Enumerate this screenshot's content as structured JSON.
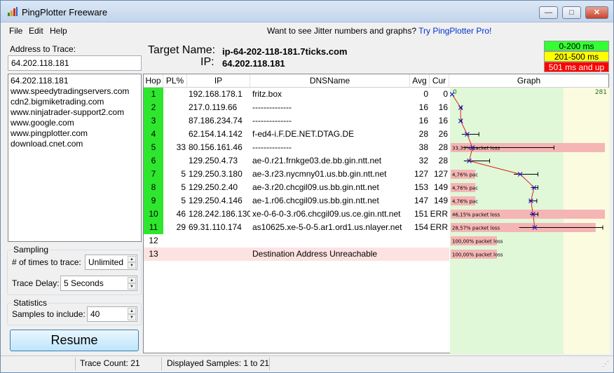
{
  "app": {
    "title": "PingPlotter Freeware"
  },
  "window_controls": {
    "minimize": "—",
    "maximize": "□",
    "close": "✕"
  },
  "menu": {
    "items": [
      "File",
      "Edit",
      "Help"
    ]
  },
  "promo": {
    "text": "Want to see Jitter numbers and graphs?",
    "link": "Try PingPlotter Pro!"
  },
  "address": {
    "label": "Address to Trace:",
    "value": "64.202.118.181"
  },
  "history": [
    "64.202.118.181",
    "www.speedytradingservers.com",
    "cdn2.bigmiketrading.com",
    "www.ninjatrader-support2.com",
    "www.google.com",
    "www.pingplotter.com",
    "download.cnet.com"
  ],
  "sampling": {
    "title": "Sampling",
    "times_label": "# of times to trace:",
    "times_value": "Unlimited",
    "delay_label": "Trace Delay:",
    "delay_value": "5 Seconds"
  },
  "statistics": {
    "title": "Statistics",
    "samples_label": "Samples to include:",
    "samples_value": "40"
  },
  "resume_button": {
    "label": "Resume"
  },
  "target": {
    "name_label": "Target Name:",
    "name_value": "ip-64-202-118-181.7ticks.com",
    "ip_label": "IP:",
    "ip_value": "64.202.118.181"
  },
  "legend": [
    {
      "label": "0-200 ms",
      "color": "#33ff33"
    },
    {
      "label": "201-500 ms",
      "color": "#ffff00"
    },
    {
      "label": "501 ms and up",
      "color": "#ff0000"
    }
  ],
  "table": {
    "headers": [
      "Hop",
      "PL%",
      "IP",
      "DNSName",
      "Avg",
      "Cur",
      "Graph"
    ],
    "graph_scale": {
      "min_label": "0",
      "max_label": "281",
      "max_ms": 281
    },
    "rows": [
      {
        "hop": "1",
        "pl": "",
        "ip": "192.168.178.1",
        "dns": "fritz.box",
        "avg": "0",
        "cur": "0",
        "reached": true,
        "ms": 0,
        "err_min": 0,
        "err_max": 0,
        "loss_label": ""
      },
      {
        "hop": "2",
        "pl": "",
        "ip": "217.0.119.66",
        "dns": "--------------",
        "avg": "16",
        "cur": "16",
        "reached": true,
        "ms": 16,
        "err_min": 14,
        "err_max": 18,
        "loss_label": ""
      },
      {
        "hop": "3",
        "pl": "",
        "ip": "87.186.234.74",
        "dns": "--------------",
        "avg": "16",
        "cur": "16",
        "reached": true,
        "ms": 16,
        "err_min": 14,
        "err_max": 18,
        "loss_label": ""
      },
      {
        "hop": "4",
        "pl": "",
        "ip": "62.154.14.142",
        "dns": "f-ed4-i.F.DE.NET.DTAG.DE",
        "avg": "28",
        "cur": "26",
        "reached": true,
        "ms": 28,
        "err_min": 18,
        "err_max": 50,
        "loss_label": ""
      },
      {
        "hop": "5",
        "pl": "33",
        "ip": "80.156.161.46",
        "dns": "--------------",
        "avg": "38",
        "cur": "28",
        "reached": true,
        "ms": 38,
        "err_min": 20,
        "err_max": 190,
        "loss_label": "33,33% packet loss",
        "loss_frac": 1.0
      },
      {
        "hop": "6",
        "pl": "",
        "ip": "129.250.4.73",
        "dns": "ae-0.r21.frnkge03.de.bb.gin.ntt.net",
        "avg": "32",
        "cur": "28",
        "reached": true,
        "ms": 32,
        "err_min": 22,
        "err_max": 70,
        "loss_label": ""
      },
      {
        "hop": "7",
        "pl": "5",
        "ip": "129.250.3.180",
        "dns": "ae-3.r23.nycmny01.us.bb.gin.ntt.net",
        "avg": "127",
        "cur": "127",
        "reached": true,
        "ms": 127,
        "err_min": 115,
        "err_max": 160,
        "loss_label": "4,76% pac",
        "loss_frac": 0.16
      },
      {
        "hop": "8",
        "pl": "5",
        "ip": "129.250.2.40",
        "dns": "ae-3.r20.chcgil09.us.bb.gin.ntt.net",
        "avg": "153",
        "cur": "149",
        "reached": true,
        "ms": 153,
        "err_min": 147,
        "err_max": 160,
        "loss_label": "4,76% pac",
        "loss_frac": 0.16
      },
      {
        "hop": "9",
        "pl": "5",
        "ip": "129.250.4.146",
        "dns": "ae-1.r06.chcgil09.us.bb.gin.ntt.net",
        "avg": "147",
        "cur": "149",
        "reached": true,
        "ms": 147,
        "err_min": 143,
        "err_max": 158,
        "loss_label": "4,76% pac",
        "loss_frac": 0.16
      },
      {
        "hop": "10",
        "pl": "46",
        "ip": "128.242.186.130",
        "dns": "xe-0-6-0-3.r06.chcgil09.us.ce.gin.ntt.net",
        "avg": "151",
        "cur": "ERR",
        "reached": true,
        "ms": 151,
        "err_min": 145,
        "err_max": 160,
        "loss_label": "46,15% packet loss",
        "loss_frac": 1.0
      },
      {
        "hop": "11",
        "pl": "29",
        "ip": "69.31.110.174",
        "dns": "as10625.xe-5-0-5.ar1.ord1.us.nlayer.net",
        "avg": "154",
        "cur": "ERR",
        "reached": true,
        "ms": 154,
        "err_min": 125,
        "err_max": 281,
        "loss_label": "28,57% packet loss",
        "loss_frac": 0.94
      },
      {
        "hop": "12",
        "pl": "",
        "ip": "",
        "dns": "",
        "avg": "",
        "cur": "",
        "reached": false,
        "ms": null,
        "loss_label": "100,00% packet loss",
        "loss_frac": 0.3
      },
      {
        "hop": "13",
        "pl": "",
        "ip": "",
        "dns": "Destination Address Unreachable",
        "avg": "",
        "cur": "",
        "reached": false,
        "unreachable": true,
        "ms": null,
        "loss_label": "100,00% packet loss",
        "loss_frac": 0.3
      }
    ]
  },
  "status": {
    "trace_count": "Trace Count: 21",
    "displayed": "Displayed Samples: 1 to 21"
  },
  "colors": {
    "hop_ok": "#2ee62e",
    "loss_bar": "#f5b5b5",
    "graph_green": "#e0f8d8",
    "graph_yellow": "#fbfbe0",
    "unreachable_row": "#fde2e2"
  }
}
